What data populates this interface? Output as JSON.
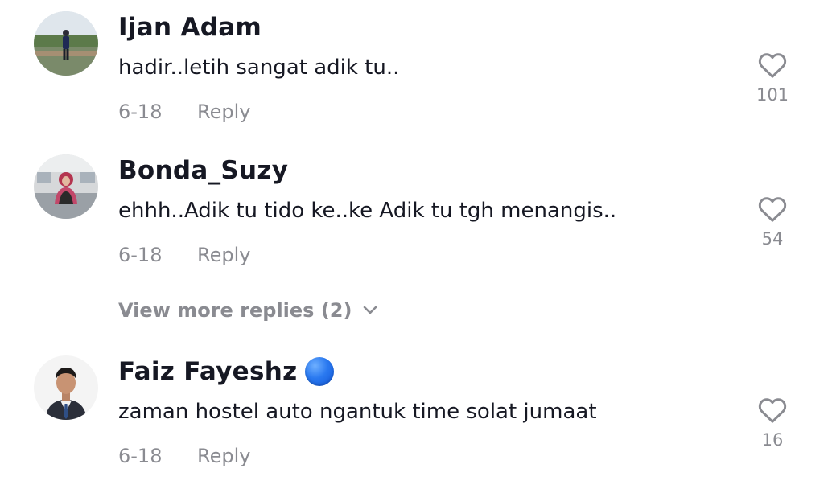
{
  "comments": [
    {
      "username": "Ijan Adam",
      "text": "hadir..letih sangat adik tu..",
      "date": "6-18",
      "reply_label": "Reply",
      "likes": "101",
      "verified": false
    },
    {
      "username": "Bonda_Suzy",
      "text": "ehhh..Adik tu tido ke..ke Adik tu tgh menangis..",
      "date": "6-18",
      "reply_label": "Reply",
      "likes": "54",
      "verified": false
    },
    {
      "username": "Faiz Fayeshz",
      "text": "zaman hostel auto ngantuk time solat jumaat",
      "date": "6-18",
      "reply_label": "Reply",
      "likes": "16",
      "verified": true
    }
  ],
  "view_more_replies": "View more replies (2)",
  "icons": {
    "like": "heart-outline-icon",
    "expand": "chevron-down-icon",
    "verified": "verified-badge-icon"
  },
  "colors": {
    "text_primary": "#161823",
    "text_secondary": "#8a8b91",
    "verified_badge": "#2a79f0"
  }
}
